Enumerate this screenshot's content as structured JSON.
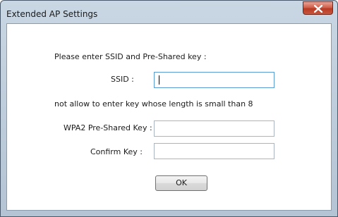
{
  "window": {
    "title": "Extended AP Settings"
  },
  "form": {
    "instruction": "Please enter SSID and Pre-Shared key :",
    "ssid_label": "SSID :",
    "ssid_value": "",
    "note": "not allow to enter key whose length is small than 8",
    "psk_label": "WPA2 Pre-Shared Key :",
    "psk_value": "",
    "confirm_label": "Confirm Key :",
    "confirm_value": "",
    "ok_label": "OK"
  },
  "colors": {
    "close_button": "#c8553c",
    "focus_border": "#5b9bd5"
  },
  "icons": {
    "close": "close-icon"
  }
}
